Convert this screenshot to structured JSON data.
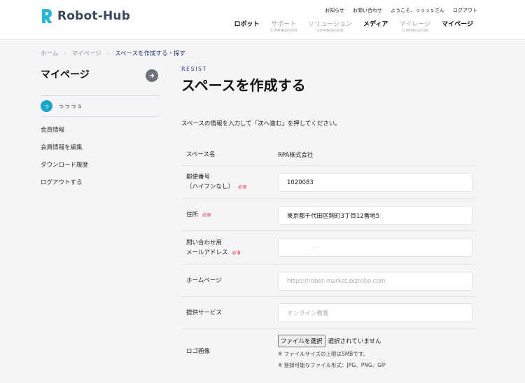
{
  "header": {
    "logo_text": "Robot-Hub",
    "util_links": [
      "お知らせ",
      "お問い合わせ",
      "ようこそ、っっっｓさん",
      "ログアウト"
    ],
    "nav": [
      {
        "label": "ロボット",
        "sub": ""
      },
      {
        "label": "サポート",
        "sub": "COMINGSOON"
      },
      {
        "label": "ソリューション",
        "sub": "COMINGSOON"
      },
      {
        "label": "メディア",
        "sub": ""
      },
      {
        "label": "マイレージ",
        "sub": "COMINGSOON"
      },
      {
        "label": "マイページ",
        "sub": ""
      }
    ]
  },
  "breadcrumb": {
    "items": [
      "ホーム",
      "マイページ",
      "スペースを作成する・探す"
    ],
    "separator": "›"
  },
  "sidebar": {
    "title": "マイページ",
    "avatar_char": "っ",
    "user_name": "っっっｓ",
    "menu": [
      "会員情報",
      "会員情報を編集",
      "ダウンロード履歴",
      "ログアウトする"
    ]
  },
  "main": {
    "eyebrow": "RESIST",
    "title": "スペースを作成する",
    "intro": "スペースの情報を入力して「次へ進む」を押してください。",
    "required_label": "必須",
    "fields": {
      "space_name": {
        "label": "スペース名",
        "value": "RPA株式会社"
      },
      "postal": {
        "label_line1": "郵便番号",
        "label_line2": "（ハイフンなし）",
        "value": "1020083"
      },
      "address": {
        "label": "住所",
        "value": "東京都千代田区麹町3丁目12番地5"
      },
      "email": {
        "label_line1": "問い合わせ用",
        "label_line2": "メールアドレス",
        "value": "- -"
      },
      "homepage": {
        "label": "ホームページ",
        "placeholder": "https://robot-market.bizrobo.com"
      },
      "service": {
        "label": "提供サービス",
        "placeholder": "オンライン教育"
      },
      "logo": {
        "label": "ロゴ画像",
        "button": "ファイルを選択",
        "status": "選択されていません",
        "note1": "※ ファイルサイズの上限は5MBです。",
        "note2": "※ 登録可能なファイル形式：JPG、PNG、GIF"
      }
    }
  },
  "colors": {
    "accent": "#1aa5c9",
    "navy": "#2a3a7a",
    "required": "#dd2233",
    "band": "#f4f5f7"
  },
  "icons": {
    "logo": "robot-hub-logo-mark",
    "go": "arrow-right-circle-icon",
    "breadcrumb_sep": "chevron-right-icon"
  }
}
